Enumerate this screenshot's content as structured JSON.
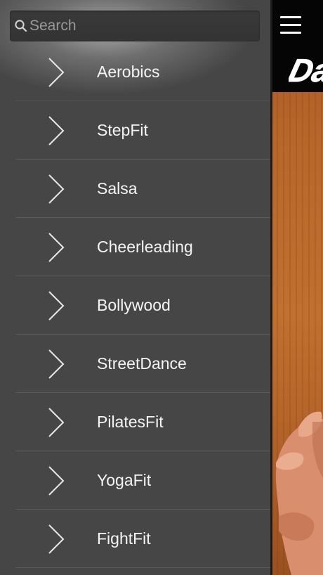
{
  "search": {
    "placeholder": "Search",
    "value": ""
  },
  "menu": {
    "items": [
      {
        "label": "Aerobics"
      },
      {
        "label": "StepFit"
      },
      {
        "label": "Salsa"
      },
      {
        "label": "Cheerleading"
      },
      {
        "label": "Bollywood"
      },
      {
        "label": "StreetDance"
      },
      {
        "label": "PilatesFit"
      },
      {
        "label": "YogaFit"
      },
      {
        "label": "FightFit"
      }
    ]
  },
  "header": {
    "menu_icon": "hamburger-icon",
    "logo_text": "Da"
  },
  "colors": {
    "drawer_bg": "#464646",
    "nav_bar_bg": "#050505",
    "label_text": "#f4f4f4"
  }
}
